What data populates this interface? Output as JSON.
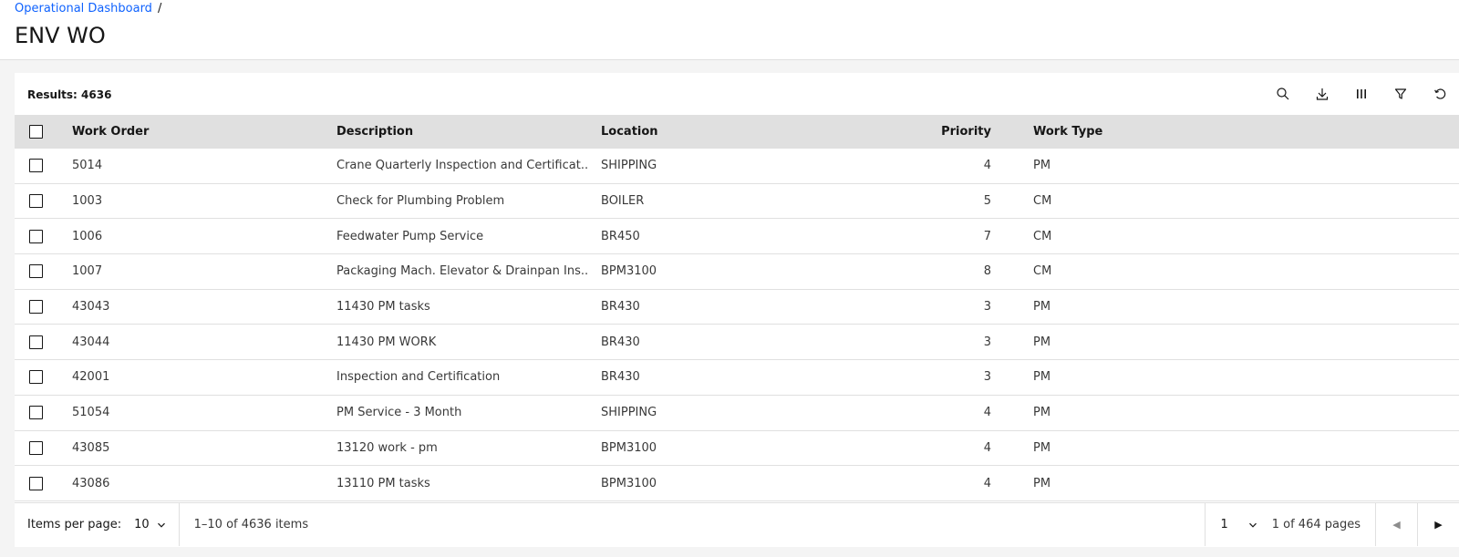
{
  "breadcrumb": {
    "link": "Operational Dashboard",
    "separator": "/"
  },
  "page_title": "ENV WO",
  "toolbar": {
    "results_label": "Results: 4636",
    "icons": [
      "search-icon",
      "download-icon",
      "columns-icon",
      "filter-icon",
      "reset-icon"
    ]
  },
  "table": {
    "columns": {
      "work_order": "Work Order",
      "description": "Description",
      "location": "Location",
      "priority": "Priority",
      "work_type": "Work Type"
    },
    "rows": [
      {
        "work_order": "5014",
        "description": "Crane Quarterly Inspection and Certificat...",
        "location": "SHIPPING",
        "priority": "4",
        "work_type": "PM"
      },
      {
        "work_order": "1003",
        "description": "Check for Plumbing Problem",
        "location": "BOILER",
        "priority": "5",
        "work_type": "CM"
      },
      {
        "work_order": "1006",
        "description": "Feedwater Pump Service",
        "location": "BR450",
        "priority": "7",
        "work_type": "CM"
      },
      {
        "work_order": "1007",
        "description": "Packaging Mach. Elevator & Drainpan Ins...",
        "location": "BPM3100",
        "priority": "8",
        "work_type": "CM"
      },
      {
        "work_order": "43043",
        "description": "11430 PM tasks",
        "location": "BR430",
        "priority": "3",
        "work_type": "PM"
      },
      {
        "work_order": "43044",
        "description": "11430 PM WORK",
        "location": "BR430",
        "priority": "3",
        "work_type": "PM"
      },
      {
        "work_order": "42001",
        "description": "Inspection and Certification",
        "location": "BR430",
        "priority": "3",
        "work_type": "PM"
      },
      {
        "work_order": "51054",
        "description": "PM Service - 3 Month",
        "location": "SHIPPING",
        "priority": "4",
        "work_type": "PM"
      },
      {
        "work_order": "43085",
        "description": "13120 work - pm",
        "location": "BPM3100",
        "priority": "4",
        "work_type": "PM"
      },
      {
        "work_order": "43086",
        "description": "13110 PM tasks",
        "location": "BPM3100",
        "priority": "4",
        "work_type": "PM"
      }
    ]
  },
  "pagination": {
    "items_per_page_label": "Items per page:",
    "items_per_page_value": "10",
    "range_text": "1–10 of 4636 items",
    "current_page": "1",
    "page_of_text": "1 of 464 pages"
  },
  "colors": {
    "link": "#0f62fe",
    "header_bg": "#e0e0e0",
    "content_bg": "#f4f4f4"
  }
}
